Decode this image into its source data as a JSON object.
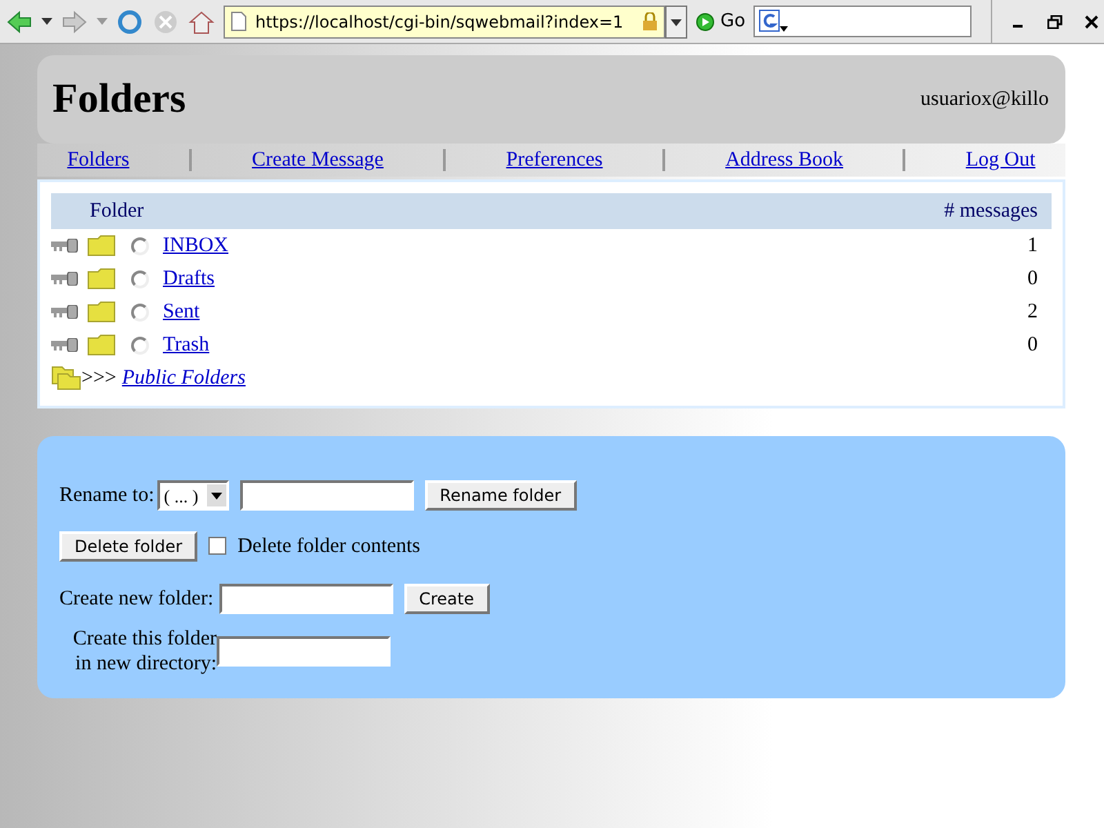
{
  "toolbar": {
    "url": "https://localhost/cgi-bin/sqwebmail?index=1",
    "go_label": "Go"
  },
  "header": {
    "title": "Folders",
    "user": "usuariox@killo"
  },
  "nav": [
    "Folders",
    "Create Message",
    "Preferences",
    "Address Book",
    "Log Out"
  ],
  "folders": {
    "columns": [
      "Folder",
      "# messages"
    ],
    "rows": [
      {
        "name": "INBOX",
        "count": "1",
        "selected": false
      },
      {
        "name": "Drafts",
        "count": "0",
        "selected": false
      },
      {
        "name": "Sent",
        "count": "2",
        "selected": false
      },
      {
        "name": "Trash",
        "count": "0",
        "selected": false
      }
    ],
    "public": {
      "prefix": ">>>",
      "label": "Public Folders"
    }
  },
  "form": {
    "rename_label": "Rename to:",
    "rename_select": "( ... )",
    "rename_button": "Rename folder",
    "delete_button": "Delete folder",
    "delete_contents": {
      "label": "Delete folder contents",
      "checked": false
    },
    "create_label": "Create new folder:",
    "create_button": "Create",
    "directory_label": "Create this folder in new directory:"
  }
}
